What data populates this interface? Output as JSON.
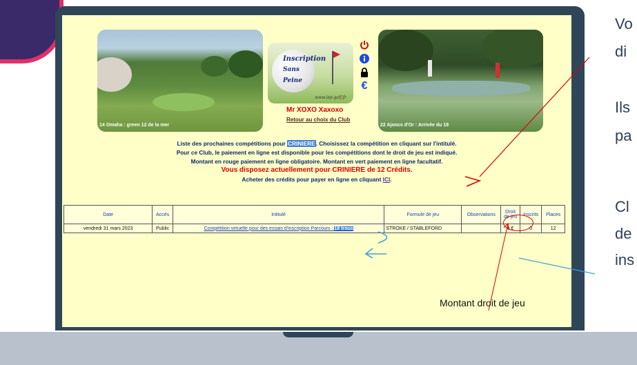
{
  "photos": {
    "left_caption": "14 Omaha : green 12 de la mer",
    "right_caption": "22 Ajoncs d'Or : Arrivée du 18"
  },
  "logo": {
    "line1": "Inscription",
    "line2": "Sans",
    "line3": "Peine",
    "url": "www.isp-golf.fr"
  },
  "icons": [
    "power-icon",
    "info-icon",
    "lock-icon",
    "euro-icon"
  ],
  "user": {
    "name": "Mr XOXO Xaxoxo",
    "back_link": "Retour au choix du Club"
  },
  "info": {
    "line1_a": "Liste des prochaines compétitions pour ",
    "club": "CRINIERE",
    "line1_b": ". Choisissez la compétition en cliquant sur l'intitulé.",
    "line2": "Pour ce Club, le paiement en ligne est disponible pour les compétitions dont le droit de jeu est indiqué.",
    "line3": "Montant en rouge paiement en ligne obligatoire. Montant en vert paiement en ligne facultatif.",
    "credits": "Vous disposez actuellement pour CRINIERE de 12 Crédits.",
    "buy_a": "Acheter des crédits pour payer en ligne en cliquant ",
    "buy_link": "ICI",
    "buy_b": "."
  },
  "table": {
    "headers": [
      "Date",
      "Accès",
      "Intitulé",
      "Formule de jeu",
      "Observations",
      "Droit de jeu",
      "Inscrits",
      "Places"
    ],
    "row": {
      "date": "vendredi 31 mars 2023",
      "access": "Public",
      "title": "Compétition virtuelle pour des essais d'inscription Parcours : ",
      "title_sel": "18 trous",
      "formula": "STROKE / STABLEFORD",
      "observations": "",
      "fee": "6 €",
      "registered": "0",
      "places": "12"
    }
  },
  "side_text": {
    "t1": "Vo",
    "t2": "di",
    "t3": "Ils",
    "t4": "pa",
    "t5": "Cl",
    "t6": "de",
    "t7": "ins"
  },
  "annotation": "Montant droit de jeu",
  "colors": {
    "screen_bg": "#ffffc8",
    "laptop": "#2f4558",
    "highlight": "#3d7de0",
    "alert": "#e00000"
  }
}
